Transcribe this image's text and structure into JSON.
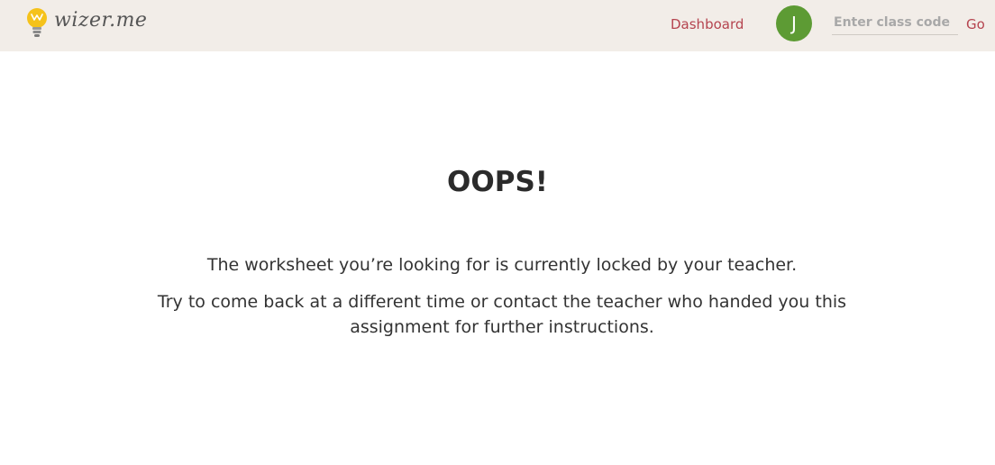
{
  "header": {
    "logo_text": "wizer.me",
    "dashboard_label": "Dashboard",
    "avatar_initial": "J",
    "class_code_placeholder": "Enter class code",
    "go_label": "Go"
  },
  "main": {
    "title": "OOPS!",
    "message_line1": "The worksheet you’re looking for is currently locked by your teacher.",
    "message_line2": "Try to come back at a different time or contact the teacher who handed you this assignment for further instructions."
  },
  "colors": {
    "header_bg": "#f2ede8",
    "accent": "#b5444f",
    "avatar_bg": "#5d9b34",
    "bulb": "#f5c21b"
  },
  "icons": {
    "logo": "lightbulb-icon"
  }
}
